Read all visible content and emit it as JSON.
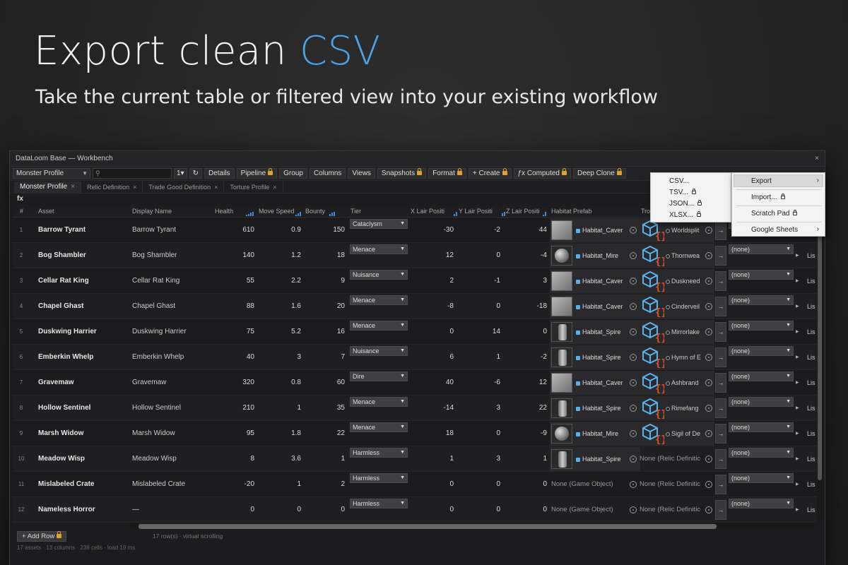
{
  "hero": {
    "title_plain": "Export clean ",
    "title_accent": "CSV",
    "subtitle": "Take the current table or filtered view into your existing workflow"
  },
  "window": {
    "title": "DataLoom Base — Workbench",
    "close": "×"
  },
  "toolbar": {
    "profile_select": "Monster Profile",
    "filter_label": "1▾",
    "buttons": [
      {
        "label": "Details",
        "locked": false
      },
      {
        "label": "Pipeline",
        "locked": true
      },
      {
        "label": "Group",
        "locked": false
      },
      {
        "label": "Columns",
        "locked": false
      },
      {
        "label": "Views",
        "locked": false
      },
      {
        "label": "Snapshots",
        "locked": true
      },
      {
        "label": "Format",
        "locked": true
      },
      {
        "label": "+ Create",
        "locked": true
      },
      {
        "label": "ƒx Computed",
        "locked": true
      },
      {
        "label": "Deep Clone",
        "locked": true
      }
    ]
  },
  "tabs": [
    {
      "label": "Monster Profile",
      "close": "×",
      "active": true
    },
    {
      "label": "Relic Definition",
      "close": "×",
      "active": false
    },
    {
      "label": "Trade Good Definition",
      "close": "×",
      "active": false
    },
    {
      "label": "Torture Profile",
      "close": "×",
      "active": false
    }
  ],
  "formula_bar": "fx",
  "columns": {
    "idx": "#",
    "asset": "Asset",
    "display": "Display Name",
    "health": "Health",
    "move": "Move Speed",
    "bounty": "Bounty",
    "tier": "Tier",
    "x": "X Lair Positi",
    "y": "Y Lair Positi",
    "z": "Z Lair Positi",
    "prefab": "Habitat Prefab",
    "trope": "Tro"
  },
  "rows": [
    {
      "i": "1",
      "asset": "Barrow Tyrant",
      "display": "Barrow Tyrant",
      "health": "610",
      "move": "0.9",
      "bounty": "150",
      "tier": "Cataclysm",
      "x": "-30",
      "y": "-2",
      "z": "44",
      "mesh": "cube",
      "prefab": "Habitat_Caver",
      "relic": "Worldsplit",
      "lis": "Lis"
    },
    {
      "i": "2",
      "asset": "Bog Shambler",
      "display": "Bog Shambler",
      "health": "140",
      "move": "1.2",
      "bounty": "18",
      "tier": "Menace",
      "x": "12",
      "y": "0",
      "z": "-4",
      "mesh": "sphere",
      "prefab": "Habitat_Mire",
      "relic": "Thornwea",
      "lis": "Lis"
    },
    {
      "i": "3",
      "asset": "Cellar Rat King",
      "display": "Cellar Rat King",
      "health": "55",
      "move": "2.2",
      "bounty": "9",
      "tier": "Nuisance",
      "x": "2",
      "y": "-1",
      "z": "3",
      "mesh": "cube",
      "prefab": "Habitat_Caver",
      "relic": "Duskneed",
      "lis": "Lis"
    },
    {
      "i": "4",
      "asset": "Chapel Ghast",
      "display": "Chapel Ghast",
      "health": "88",
      "move": "1.6",
      "bounty": "20",
      "tier": "Menace",
      "x": "-8",
      "y": "0",
      "z": "-18",
      "mesh": "cube",
      "prefab": "Habitat_Caver",
      "relic": "Cinderveil",
      "lis": "Lis"
    },
    {
      "i": "5",
      "asset": "Duskwing Harrier",
      "display": "Duskwing Harrier",
      "health": "75",
      "move": "5.2",
      "bounty": "16",
      "tier": "Menace",
      "x": "0",
      "y": "14",
      "z": "0",
      "mesh": "cyl",
      "prefab": "Habitat_Spire",
      "relic": "Mirrorlake",
      "lis": "Lis"
    },
    {
      "i": "6",
      "asset": "Emberkin Whelp",
      "display": "Emberkin Whelp",
      "health": "40",
      "move": "3",
      "bounty": "7",
      "tier": "Nuisance",
      "x": "6",
      "y": "1",
      "z": "-2",
      "mesh": "cyl",
      "prefab": "Habitat_Spire",
      "relic": "Hymn of E",
      "lis": "Lis"
    },
    {
      "i": "7",
      "asset": "Gravemaw",
      "display": "Gravemaw",
      "health": "320",
      "move": "0.8",
      "bounty": "60",
      "tier": "Dire",
      "x": "40",
      "y": "-6",
      "z": "12",
      "mesh": "cube",
      "prefab": "Habitat_Caver",
      "relic": "Ashbrand",
      "lis": "Lis"
    },
    {
      "i": "8",
      "asset": "Hollow Sentinel",
      "display": "Hollow Sentinel",
      "health": "210",
      "move": "1",
      "bounty": "35",
      "tier": "Menace",
      "x": "-14",
      "y": "3",
      "z": "22",
      "mesh": "cyl",
      "prefab": "Habitat_Spire",
      "relic": "Rimefang",
      "lis": "Lis"
    },
    {
      "i": "9",
      "asset": "Marsh Widow",
      "display": "Marsh Widow",
      "health": "95",
      "move": "1.8",
      "bounty": "22",
      "tier": "Menace",
      "x": "18",
      "y": "0",
      "z": "-9",
      "mesh": "sphere",
      "prefab": "Habitat_Mire",
      "relic": "Sigil of De",
      "lis": "Lis"
    },
    {
      "i": "10",
      "asset": "Meadow Wisp",
      "display": "Meadow Wisp",
      "health": "8",
      "move": "3.6",
      "bounty": "1",
      "tier": "Harmless",
      "x": "1",
      "y": "3",
      "z": "1",
      "mesh": "cyl",
      "prefab": "Habitat_Spire",
      "relic": "",
      "relic_none": "None (Relic Definitic",
      "lis": "Lis"
    },
    {
      "i": "11",
      "asset": "Mislabeled Crate",
      "display": "Mislabeled Crate",
      "health": "-20",
      "move": "1",
      "bounty": "2",
      "tier": "Harmless",
      "x": "0",
      "y": "0",
      "z": "0",
      "mesh": "",
      "prefab_none": "None (Game Object)",
      "relic": "",
      "relic_none": "None (Relic Definitic",
      "lis": "Lis"
    },
    {
      "i": "12",
      "asset": "Nameless Horror",
      "display": "—",
      "health": "0",
      "move": "0",
      "bounty": "0",
      "tier": "Harmless",
      "x": "0",
      "y": "0",
      "z": "0",
      "mesh": "",
      "prefab_none": "None (Game Object)",
      "relic": "",
      "relic_none": "None (Relic Definitic",
      "lis": "Lis"
    }
  ],
  "none_select": "(none)",
  "footer": {
    "add_row": "+ Add Row",
    "row_info": "17 row(s) · virtual scrolling",
    "status": "17 assets · 13 columns · 238 cells · load 19 ms"
  },
  "export_menu": {
    "items": [
      "CSV...",
      "TSV...",
      "JSON...",
      "XLSX..."
    ]
  },
  "main_menu": {
    "items": [
      "Export",
      "Import...",
      "Scratch Pad",
      "Google Sheets"
    ]
  },
  "colors": {
    "accent": "#4aa3e8",
    "lock": "#e0a030",
    "spark": "#3a8de0"
  }
}
